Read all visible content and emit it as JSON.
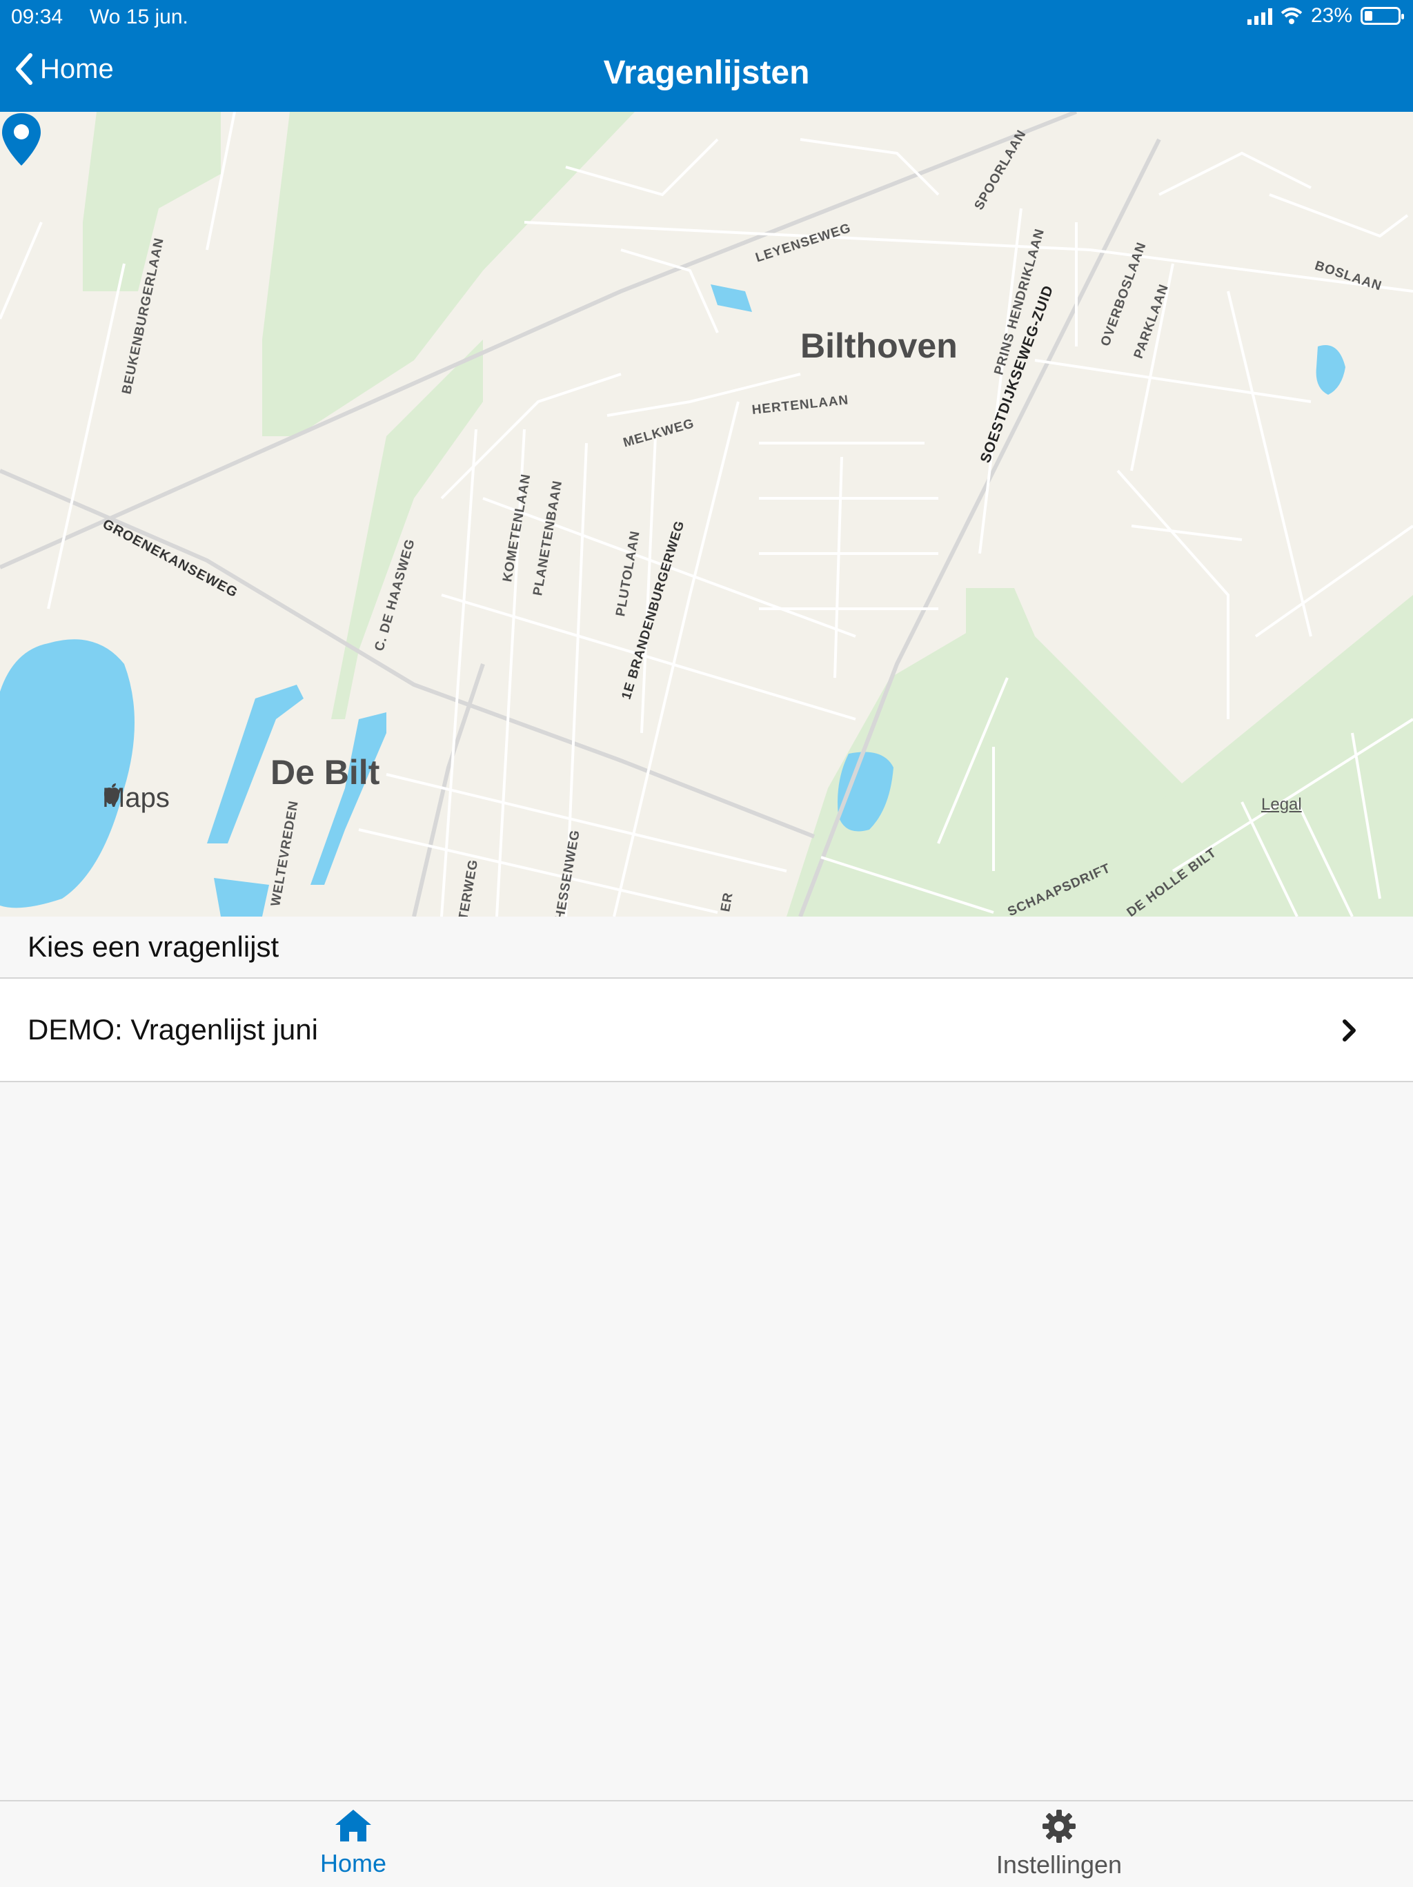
{
  "status_bar": {
    "time": "09:34",
    "date": "Wo 15 jun.",
    "battery": "23%"
  },
  "nav": {
    "back_label": "Home",
    "title": "Vragenlijsten"
  },
  "map": {
    "places": [
      "Bilthoven",
      "De Bilt"
    ],
    "streets": [
      "LEYENSEWEG",
      "SPOORLAAN",
      "BOSLAAN",
      "PRINS HENDRIKLAAN",
      "SOESTDIJKSEWEG-ZUID",
      "OVERBOSLAAN",
      "PARKLAAN",
      "BEUKENBURGERLAAN",
      "MELKWEG",
      "HERTENLAAN",
      "GROENEKANSEWEG",
      "KOMETENLAAN",
      "PLANETENBAAN",
      "PLUTOLAAN",
      "1E BRANDENBURGERWEG",
      "C. DE HAASWEG",
      "WELTEVREDEN",
      "TERWEG",
      "HESSENWEG",
      "ER",
      "SCHAAPSDRIFT",
      "DE HOLLE BILT"
    ],
    "brand": "Maps",
    "legal": "Legal"
  },
  "section": {
    "header": "Kies een vragenlijst"
  },
  "list": {
    "items": [
      {
        "label": "DEMO: Vragenlijst juni"
      }
    ]
  },
  "tabs": [
    {
      "label": "Home",
      "icon": "home-icon"
    },
    {
      "label": "Instellingen",
      "icon": "gear-icon"
    }
  ],
  "colors": {
    "accent": "#0079c8",
    "water": "#7fd0f2",
    "park": "#dcedd3"
  }
}
